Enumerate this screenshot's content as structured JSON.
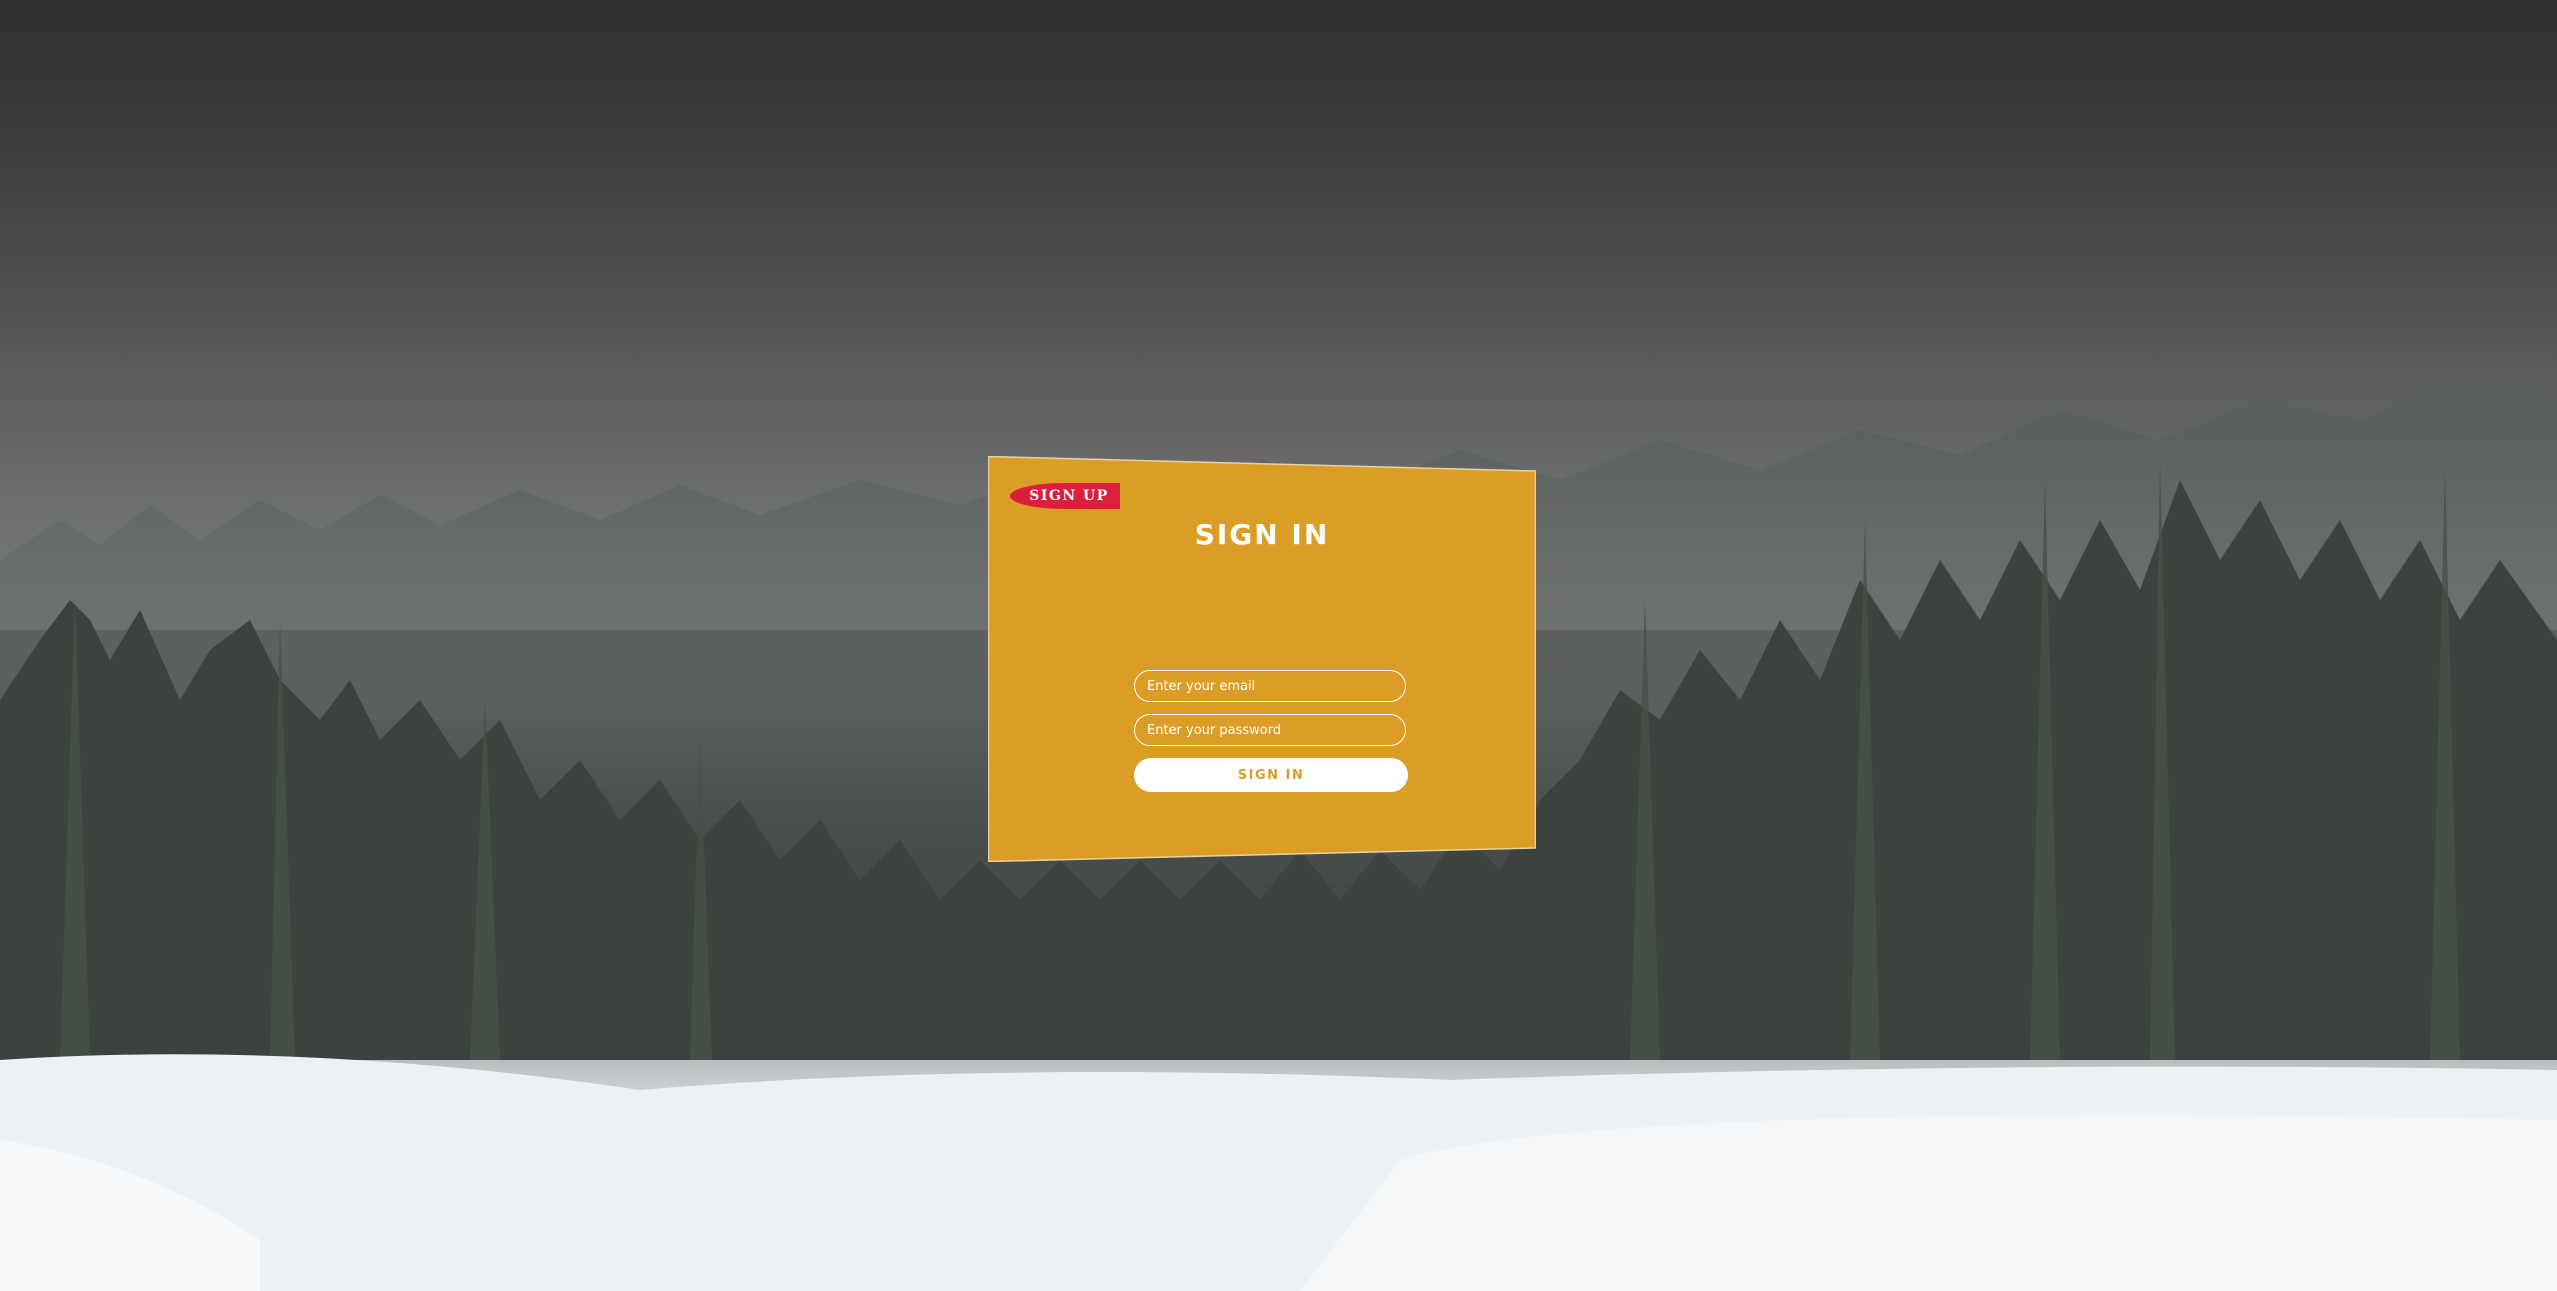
{
  "colors": {
    "card_background": "#dc9d27",
    "signup_tab": "#dc1f3c",
    "text": "#ffffff",
    "button_background": "#ffffff",
    "button_text": "#dc9d27"
  },
  "background": {
    "description_icon": "snowy-forest-lake-icon"
  },
  "signup_tab": {
    "label": "SIGN UP"
  },
  "form": {
    "title": "SIGN IN",
    "email": {
      "value": "",
      "placeholder": "Enter your email"
    },
    "password": {
      "value": "",
      "placeholder": "Enter your password"
    },
    "submit_label": "SIGN IN"
  }
}
